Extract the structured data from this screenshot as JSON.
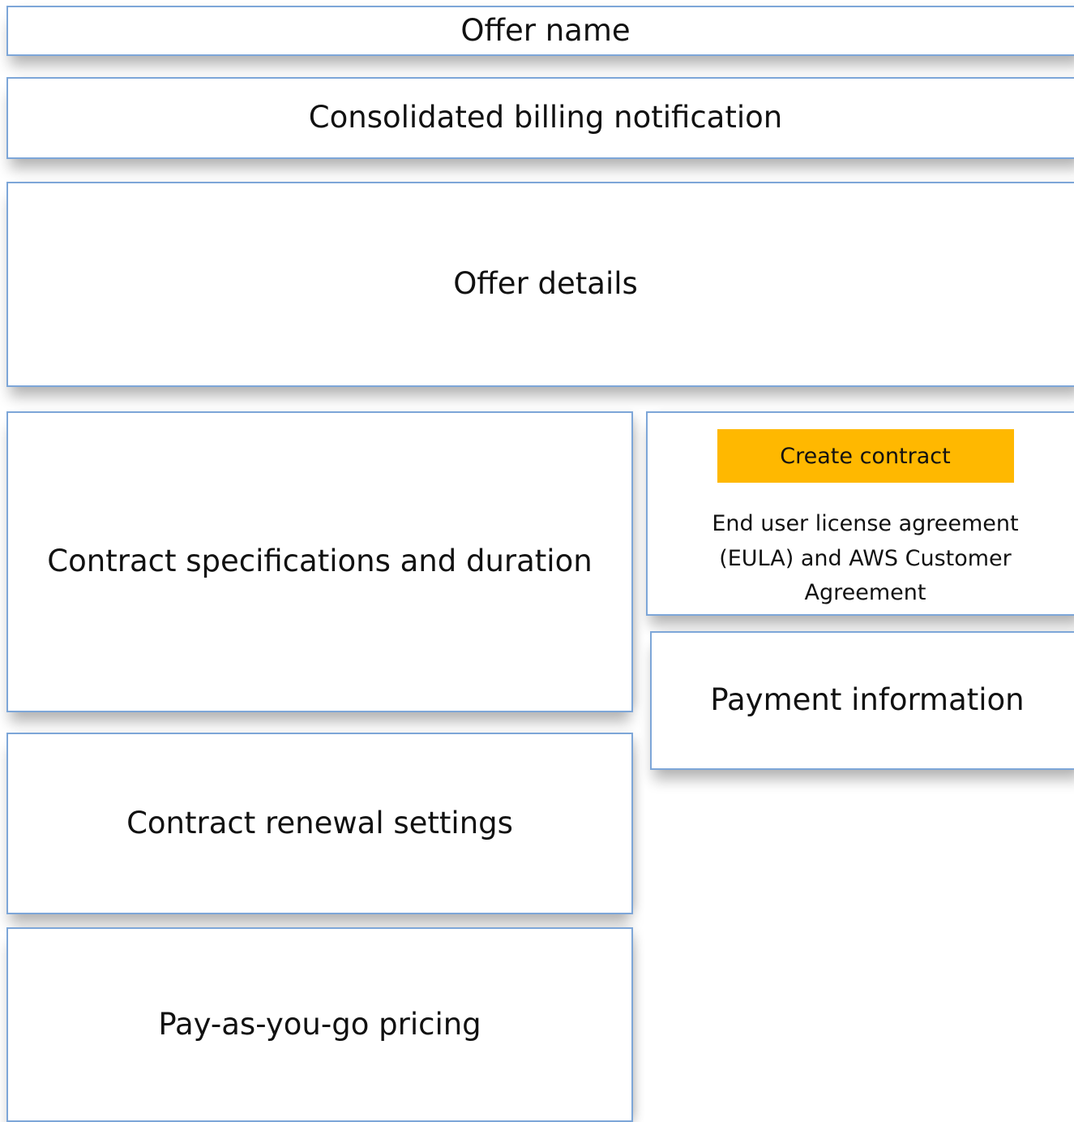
{
  "sections": {
    "offer_name": "Offer name",
    "consolidated_billing": "Consolidated billing notification",
    "offer_details": "Offer details",
    "contract_specifications": "Contract specifications and duration",
    "contract_renewal": "Contract renewal settings",
    "pay_as_you_go": "Pay-as-you-go pricing",
    "payment_information": "Payment information"
  },
  "create_panel": {
    "button_label": "Create contract",
    "agreement_text": "End user license agreement (EULA) and AWS Customer Agreement"
  },
  "colors": {
    "button_bg": "#ffb800",
    "panel_border": "#7da6d8"
  }
}
